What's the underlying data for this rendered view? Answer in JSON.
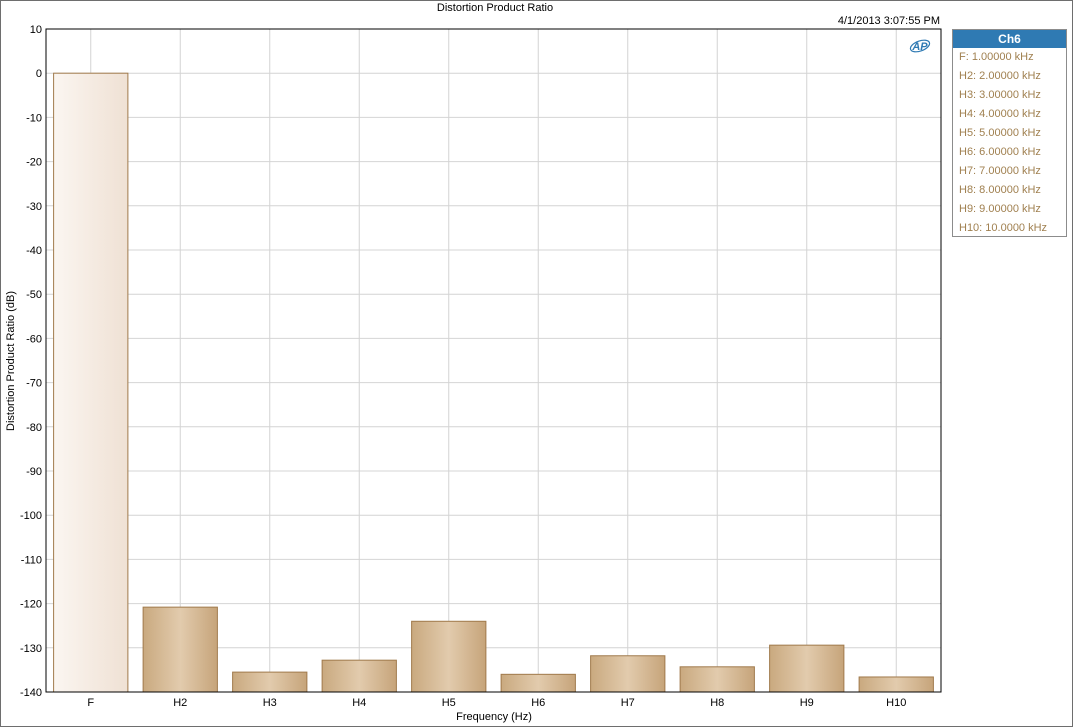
{
  "chart_data": {
    "type": "bar",
    "title": "Distortion Product Ratio",
    "timestamp": "4/1/2013 3:07:55 PM",
    "logo": "AP",
    "xlabel": "Frequency (Hz)",
    "ylabel": "Distortion Product Ratio (dB)",
    "ylim": [
      -140,
      10
    ],
    "yticks": [
      10,
      0,
      -10,
      -20,
      -30,
      -40,
      -50,
      -60,
      -70,
      -80,
      -90,
      -100,
      -110,
      -120,
      -130,
      -140
    ],
    "grid": true,
    "categories": [
      "F",
      "H2",
      "H3",
      "H4",
      "H5",
      "H6",
      "H7",
      "H8",
      "H9",
      "H10"
    ],
    "values": [
      0,
      -120.8,
      -135.5,
      -132.8,
      -124.0,
      -136.0,
      -131.8,
      -134.3,
      -129.4,
      -136.6
    ],
    "bar_colors": {
      "fundamental": "#f4e9df",
      "harmonic": "#d4b893",
      "edge": "#a07a4c"
    },
    "legend": {
      "title": "Ch6",
      "items": [
        "F: 1.00000 kHz",
        "H2: 2.00000 kHz",
        "H3: 3.00000 kHz",
        "H4: 4.00000 kHz",
        "H5: 5.00000 kHz",
        "H6: 6.00000 kHz",
        "H7: 7.00000 kHz",
        "H8: 8.00000 kHz",
        "H9: 9.00000 kHz",
        "H10: 10.0000 kHz"
      ]
    }
  }
}
